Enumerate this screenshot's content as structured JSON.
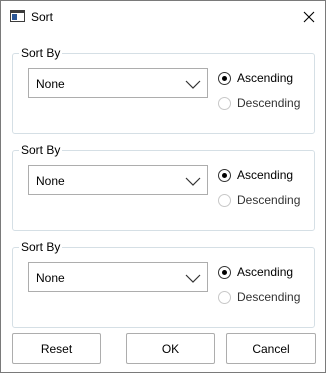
{
  "window": {
    "title": "Sort",
    "icon": "window-app-icon",
    "close_icon": "close-icon"
  },
  "groups": [
    {
      "label": "Sort By",
      "combo_value": "None",
      "ascending": "Ascending",
      "descending": "Descending",
      "selected": "Ascending"
    },
    {
      "label": "Sort By",
      "combo_value": "None",
      "ascending": "Ascending",
      "descending": "Descending",
      "selected": "Ascending"
    },
    {
      "label": "Sort By",
      "combo_value": "None",
      "ascending": "Ascending",
      "descending": "Descending",
      "selected": "Ascending"
    }
  ],
  "buttons": {
    "reset": "Reset",
    "ok": "OK",
    "cancel": "Cancel"
  },
  "colors": {
    "group_border": "#d5dfe5",
    "control_border": "#adadad",
    "window_border": "#7a7a7a"
  }
}
